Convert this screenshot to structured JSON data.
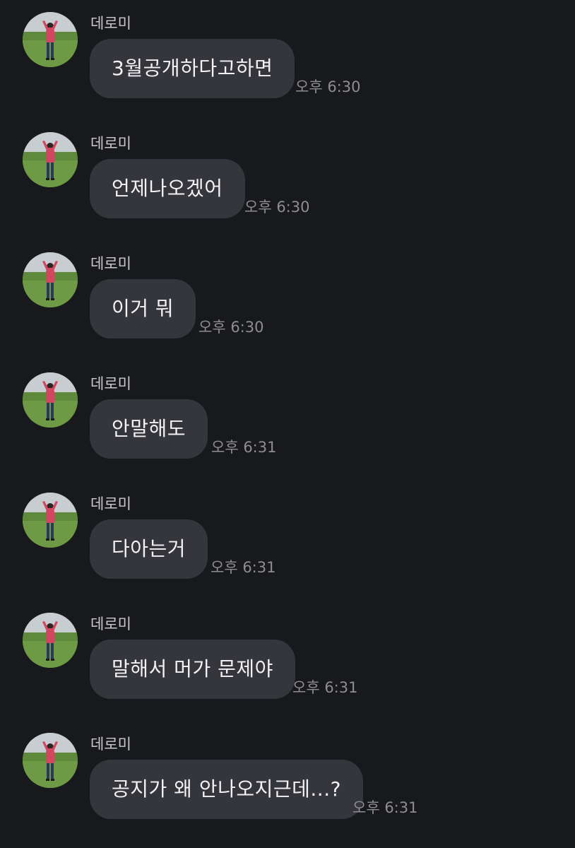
{
  "messages": [
    {
      "sender": "데로미",
      "text": "3월공개하다고하면",
      "time": "오후 6:30"
    },
    {
      "sender": "데로미",
      "text": "언제나오겠어",
      "time": "오후 6:30"
    },
    {
      "sender": "데로미",
      "text": "이거 뭐",
      "time": "오후 6:30"
    },
    {
      "sender": "데로미",
      "text": "안말해도",
      "time": "오후 6:31"
    },
    {
      "sender": "데로미",
      "text": "다아는거",
      "time": "오후 6:31"
    },
    {
      "sender": "데로미",
      "text": "말해서 머가 문제야",
      "time": "오후 6:31"
    },
    {
      "sender": "데로미",
      "text": "공지가 왜 안나오지근데...?",
      "time": "오후 6:31"
    }
  ],
  "colors": {
    "background": "#18191d",
    "bubble": "#35363c",
    "bubble_text": "#f2f2f4",
    "sender_text": "#c9c9cc",
    "time_text": "#8d8d92"
  },
  "icons": {
    "avatar": "profile-photo-person-in-field"
  }
}
